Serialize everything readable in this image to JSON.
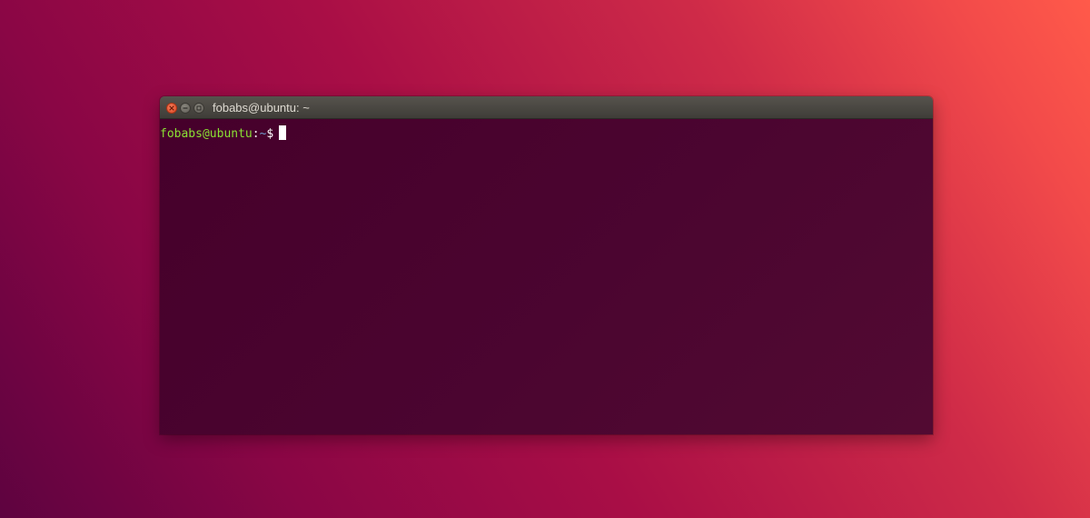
{
  "desktop": {
    "background": "Ubuntu desktop gradient"
  },
  "window": {
    "title": "fobabs@ubuntu: ~",
    "buttons": {
      "close": "close-icon",
      "minimize": "minimize-icon",
      "maximize": "maximize-icon"
    }
  },
  "terminal": {
    "prompt_user_host": "fobabs@ubuntu",
    "prompt_separator": ":",
    "prompt_path": "~",
    "prompt_symbol": "$",
    "input_text": ""
  },
  "colors": {
    "terminal_background": "#4a0a2e",
    "titlebar": "#4b4944",
    "prompt_user": "#8ae234",
    "prompt_path": "#729fcf",
    "close_button": "#e95420"
  }
}
